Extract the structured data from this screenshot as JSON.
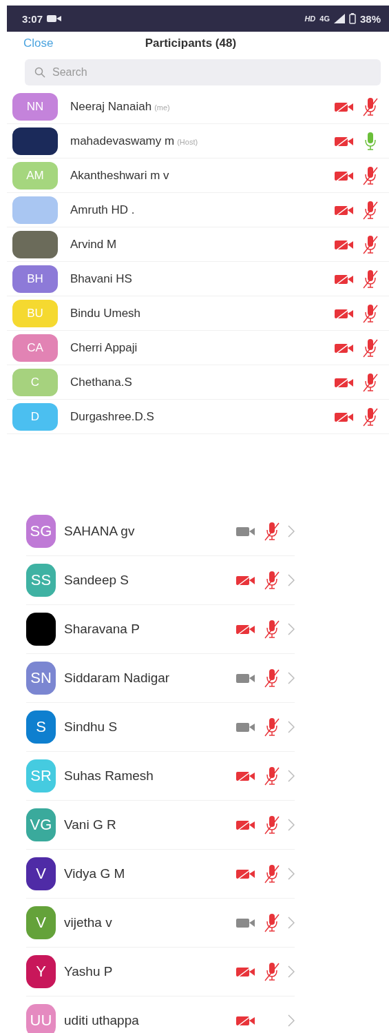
{
  "status_bar": {
    "time": "3:07",
    "network": "HD",
    "signal": "4G",
    "battery": "38%"
  },
  "header": {
    "close": "Close",
    "title": "Participants (48)"
  },
  "search": {
    "placeholder": "Search"
  },
  "participants": [
    {
      "kind": "initials",
      "initials": "NN",
      "color": "#c483db",
      "name": "Neeraj Nanaiah",
      "tag": "(me)",
      "video_on": false,
      "mic_muted": true
    },
    {
      "kind": "photo",
      "color": "#1b2a5a",
      "name": "mahadevaswamy m",
      "tag": "(Host)",
      "video_on": false,
      "mic_muted": false
    },
    {
      "kind": "initials",
      "initials": "AM",
      "color": "#a5d67e",
      "name": "Akantheshwari m v",
      "video_on": false,
      "mic_muted": true
    },
    {
      "kind": "blank",
      "color": "#a9c6f2",
      "name": "Amruth HD .",
      "video_on": false,
      "mic_muted": true
    },
    {
      "kind": "photo",
      "color": "#6b6b5a",
      "name": "Arvind M",
      "video_on": false,
      "mic_muted": true
    },
    {
      "kind": "initials",
      "initials": "BH",
      "color": "#8d7ad8",
      "name": "Bhavani HS",
      "video_on": false,
      "mic_muted": true
    },
    {
      "kind": "initials",
      "initials": "BU",
      "color": "#f5d930",
      "name": "Bindu Umesh",
      "video_on": false,
      "mic_muted": true
    },
    {
      "kind": "initials",
      "initials": "CA",
      "color": "#e283b4",
      "name": "Cherri Appaji",
      "video_on": false,
      "mic_muted": true
    },
    {
      "kind": "initials",
      "initials": "C",
      "color": "#a6d27e",
      "name": "Chethana.S",
      "video_on": false,
      "mic_muted": true
    },
    {
      "kind": "initials",
      "initials": "D",
      "color": "#4bbff0",
      "name": "Durgashree.D.S",
      "video_on": false,
      "mic_muted": true
    }
  ],
  "second_list": [
    {
      "kind": "initials",
      "initials": "SG",
      "color": "#bf7ad6",
      "name": "SAHANA gv",
      "video_on": true,
      "mic_muted": true
    },
    {
      "kind": "initials",
      "initials": "SS",
      "color": "#3fb2a3",
      "name": "Sandeep S",
      "video_on": false,
      "mic_muted": true
    },
    {
      "kind": "blank",
      "color": "#000000",
      "name": "Sharavana P",
      "video_on": false,
      "mic_muted": true
    },
    {
      "kind": "initials",
      "initials": "SN",
      "color": "#7b86d1",
      "name": "Siddaram Nadigar",
      "video_on": true,
      "mic_muted": true
    },
    {
      "kind": "initials",
      "initials": "S",
      "color": "#0e7fcf",
      "name": "Sindhu S",
      "video_on": true,
      "mic_muted": true
    },
    {
      "kind": "initials",
      "initials": "SR",
      "color": "#45cbe0",
      "name": "Suhas Ramesh",
      "video_on": false,
      "mic_muted": true
    },
    {
      "kind": "initials",
      "initials": "VG",
      "color": "#3aaa9c",
      "name": "Vani G R",
      "video_on": false,
      "mic_muted": true
    },
    {
      "kind": "initials",
      "initials": "V",
      "color": "#4f2ba6",
      "name": "Vidya G M",
      "video_on": false,
      "mic_muted": true
    },
    {
      "kind": "initials",
      "initials": "V",
      "color": "#64a23a",
      "name": "vijetha v",
      "video_on": true,
      "mic_muted": true
    },
    {
      "kind": "initials",
      "initials": "Y",
      "color": "#c8175a",
      "name": "Yashu P",
      "video_on": false,
      "mic_muted": true
    },
    {
      "kind": "initials",
      "initials": "UU",
      "color": "#e58ac0",
      "name": "uditi uthappa",
      "video_on": false
    }
  ]
}
